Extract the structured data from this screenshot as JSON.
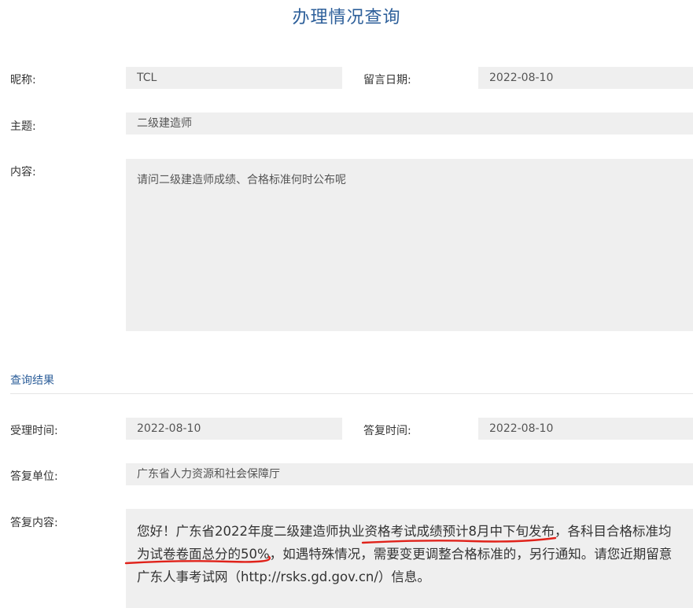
{
  "page": {
    "title": "办理情况查询"
  },
  "form": {
    "nickname_label": "昵称:",
    "nickname_value": "TCL",
    "date_label": "留言日期:",
    "date_value": "2022-08-10",
    "subject_label": "主题:",
    "subject_value": "二级建造师",
    "content_label": "内容:",
    "content_value": "请问二级建造师成绩、合格标准何时公布呢"
  },
  "result": {
    "section_title": "查询结果",
    "accept_time_label": "受理时间:",
    "accept_time_value": "2022-08-10",
    "reply_time_label": "答复时间:",
    "reply_time_value": "2022-08-10",
    "reply_unit_label": "答复单位:",
    "reply_unit_value": "广东省人力资源和社会保障厅",
    "reply_content_label": "答复内容:",
    "reply_part1": "您好！广东省2022年度二级建造师执业",
    "reply_highlight1": "资格考试成绩预计8月中下旬发布，",
    "reply_part2": "各科目合格标准均为",
    "reply_highlight2": "试卷卷面总分的50%，",
    "reply_part3": "如遇特殊情况，需要变更调整合格标准的，另行通知。请您近期留意广东人事考试网（http://rsks.gd.gov.cn/）信息。"
  },
  "colors": {
    "accent": "#2d5f9a",
    "field_bg": "#efefef",
    "annotation": "#e0221a"
  }
}
